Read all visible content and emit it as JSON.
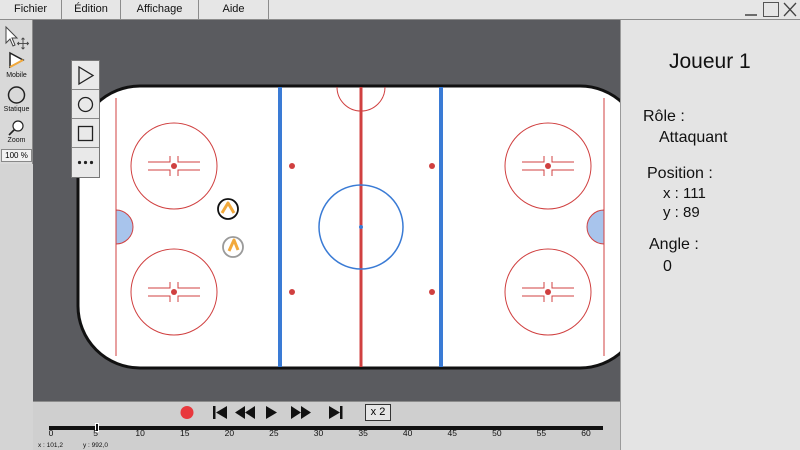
{
  "menu": {
    "items": [
      "Fichier",
      "Édition",
      "Affichage",
      "Aide"
    ]
  },
  "window_controls": [
    "minimize-icon",
    "maximize-icon",
    "close-icon"
  ],
  "tools": {
    "mobile_label": "Mobile",
    "statique_label": "Statique",
    "zoom_label": "Zoom",
    "zoom_value": "100 %"
  },
  "shapes": [
    "triangle-icon",
    "circle-icon",
    "square-icon",
    "more-icon"
  ],
  "players": [
    {
      "name": "player-selected",
      "color": "#f2a93b"
    },
    {
      "name": "player-secondary",
      "color": "#f2a93b"
    }
  ],
  "rink_colors": {
    "red_line": "#d04040",
    "blue_line": "#3a7bd5",
    "crease": "#a8c4ec",
    "boards": "#111111",
    "ice": "#ffffff"
  },
  "panel": {
    "player_title": "Joueur 1",
    "role_label": "Rôle :",
    "role_value": "Attaquant",
    "position_label": "Position :",
    "x_line": "x : 111",
    "y_line": "y : 89",
    "angle_label": "Angle :",
    "angle_value": "0"
  },
  "playback": {
    "record_color": "#e8383d",
    "speed": "x 2",
    "progress_fraction": 0.087
  },
  "timeline": {
    "ticks": [
      "0",
      "5",
      "10",
      "15",
      "20",
      "25",
      "30",
      "35",
      "40",
      "45",
      "50",
      "55",
      "60"
    ],
    "cursor_x": "x : 101,2",
    "cursor_y": "y : 992,0"
  }
}
